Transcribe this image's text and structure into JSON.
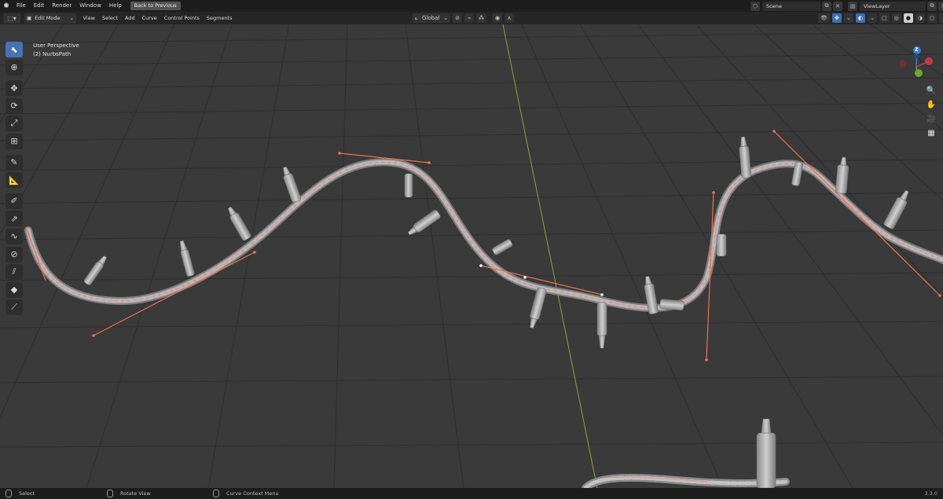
{
  "topbar": {
    "menus": [
      "File",
      "Edit",
      "Render",
      "Window",
      "Help"
    ],
    "back_button": "Back to Previous",
    "scene": "Scene",
    "view_layer": "ViewLayer"
  },
  "header": {
    "mode": "Edit Mode",
    "menus": [
      "View",
      "Select",
      "Add",
      "Curve",
      "Control Points",
      "Segments"
    ],
    "orientation": "Global"
  },
  "viewport": {
    "perspective": "User Perspective",
    "object": "(2) NurbsPath"
  },
  "gizmo": {
    "z_label": "Z",
    "x_color": "#c33a47",
    "y_color": "#6aa836",
    "z_color": "#3b7ee0"
  },
  "status": {
    "select": "Select",
    "rotate": "Rotate View",
    "context": "Curve Context Menu",
    "version": "3.3.0"
  },
  "colors": {
    "accent": "#4772b3",
    "handle": "#f07050"
  }
}
